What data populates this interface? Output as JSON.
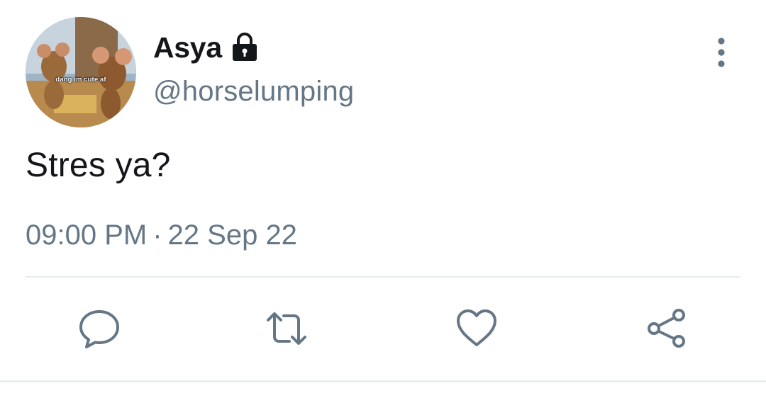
{
  "author": {
    "display_name": "Asya",
    "handle": "@horselumping",
    "avatar_caption": "dang im cute af",
    "protected_icon": "lock-icon"
  },
  "tweet": {
    "text": "Stres ya?",
    "time": "09:00 PM",
    "separator": "·",
    "date": "22 Sep 22"
  },
  "actions": {
    "reply_icon": "speech-bubble-icon",
    "retweet_icon": "retweet-icon",
    "like_icon": "heart-icon",
    "share_icon": "share-icon",
    "more_icon": "vertical-ellipsis-icon"
  },
  "colors": {
    "text_primary": "#14171a",
    "text_secondary": "#657786",
    "divider": "#e6ecf0",
    "icon": "#657786"
  }
}
